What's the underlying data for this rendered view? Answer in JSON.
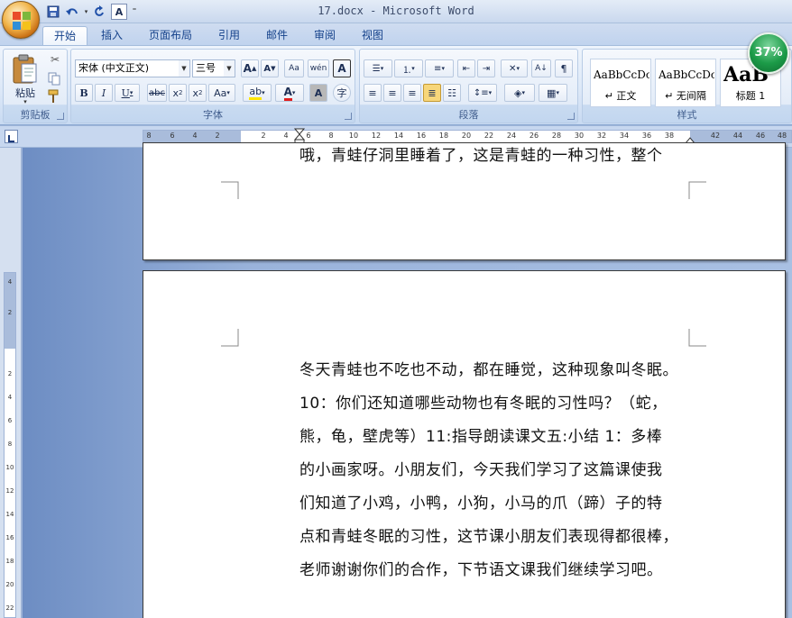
{
  "window": {
    "title": "17.docx - Microsoft Word"
  },
  "quick_access": {
    "icons": [
      "save-icon",
      "undo-icon",
      "redo-icon",
      "spelling-icon",
      "customize-icon"
    ]
  },
  "tabs": [
    {
      "label": "开始",
      "active": true
    },
    {
      "label": "插入"
    },
    {
      "label": "页面布局"
    },
    {
      "label": "引用"
    },
    {
      "label": "邮件"
    },
    {
      "label": "审阅"
    },
    {
      "label": "视图"
    }
  ],
  "ribbon": {
    "clipboard": {
      "label": "剪贴板",
      "paste_label": "粘贴"
    },
    "font": {
      "label": "字体",
      "font_name": "宋体 (中文正文)",
      "font_size": "三号"
    },
    "paragraph": {
      "label": "段落"
    },
    "styles": {
      "label": "样式",
      "cards": [
        {
          "sample": "AaBbCcDc",
          "name": "↵ 正文"
        },
        {
          "sample": "AaBbCcDc",
          "name": "↵ 无间隔"
        },
        {
          "sample": "AaB",
          "name": "标题 1"
        }
      ]
    }
  },
  "zoom": {
    "value": "37%"
  },
  "ruler": {
    "left_numbers": [
      "8",
      "6",
      "4",
      "2"
    ],
    "numbers": [
      "2",
      "4",
      "6",
      "8",
      "10",
      "12",
      "14",
      "16",
      "18",
      "20",
      "22",
      "24",
      "26",
      "28",
      "30",
      "32",
      "34",
      "36",
      "38",
      "42",
      "44",
      "46",
      "48"
    ],
    "vertical_numbers": [
      "4",
      "2",
      "2",
      "4",
      "6",
      "8",
      "10",
      "12",
      "14",
      "16",
      "18",
      "20",
      "22"
    ]
  },
  "document": {
    "page1_line": "哦，青蛙仔洞里睡着了，这是青蛙的一种习性，整个",
    "page2_lines": [
      "冬天青蛙也不吃也不动，都在睡觉，这种现象叫冬眠。",
      "10：你们还知道哪些动物也有冬眠的习性吗？（蛇，",
      "熊，龟，壁虎等）11:指导朗读课文五:小结 1：多棒",
      "的小画家呀。小朋友们，今天我们学习了这篇课使我",
      "们知道了小鸡，小鸭，小狗，小马的爪（蹄）子的特",
      "点和青蛙冬眠的习性，这节课小朋友们表现得都很棒，",
      "老师谢谢你们的合作，下节语文课我们继续学习吧。"
    ]
  }
}
